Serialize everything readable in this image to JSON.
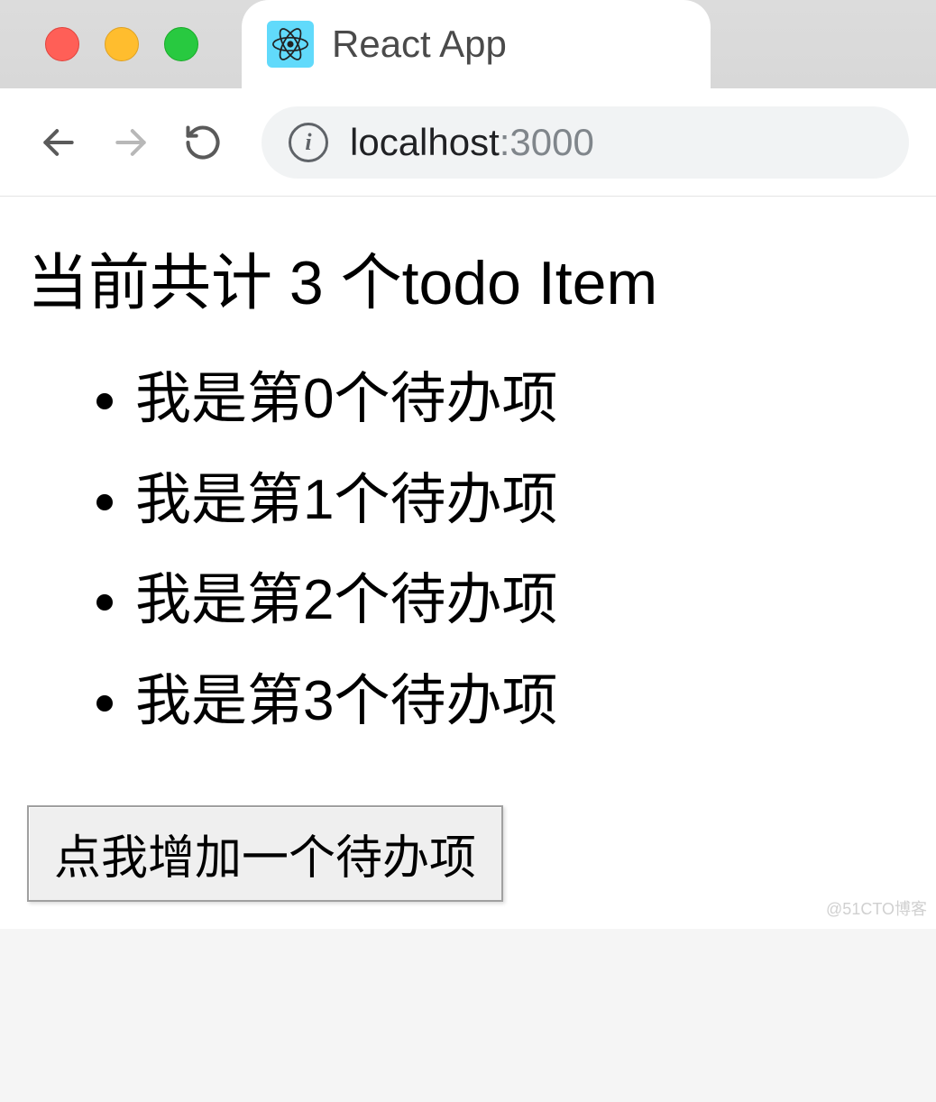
{
  "browser": {
    "tab_title": "React App",
    "url_host": "localhost",
    "url_port": ":3000"
  },
  "page": {
    "heading": "当前共计 3 个todo Item",
    "todos": [
      "我是第0个待办项",
      "我是第1个待办项",
      "我是第2个待办项",
      "我是第3个待办项"
    ],
    "add_button_label": "点我增加一个待办项"
  },
  "watermark": "@51CTO博客"
}
